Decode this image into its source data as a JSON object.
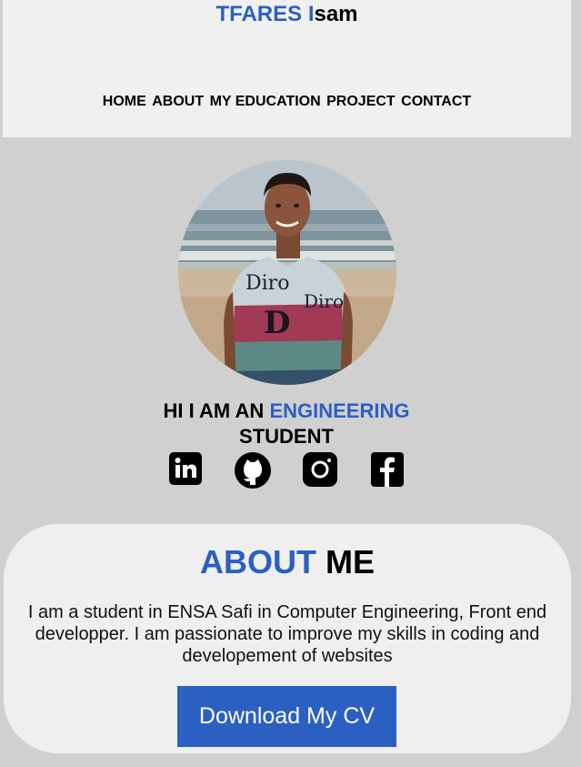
{
  "header": {
    "brand_first": "TFARES I",
    "brand_last": "sam",
    "nav": {
      "home": "HOME",
      "about": "ABOUT",
      "education": "MY EDUCATION",
      "project": "PROJECT",
      "contact": "CONTACT"
    }
  },
  "hero": {
    "line_prefix": "HI I AM AN ",
    "line_accent": "ENGINEERING",
    "line_suffix": "STUDENT",
    "socials": [
      "linkedin-icon",
      "github-icon",
      "instagram-icon",
      "facebook-icon"
    ]
  },
  "about": {
    "title_accent": "ABOUT",
    "title_rest": "ME",
    "description": "I am a student in ENSA Safi in Computer Engineering, Front end developper. I am passionate to improve my skills in coding and developement of websites",
    "cv_button": "Download My CV"
  },
  "colors": {
    "accent": "#2c5fc2",
    "background": "#d0d0d0",
    "panel": "#f0f0f0"
  }
}
